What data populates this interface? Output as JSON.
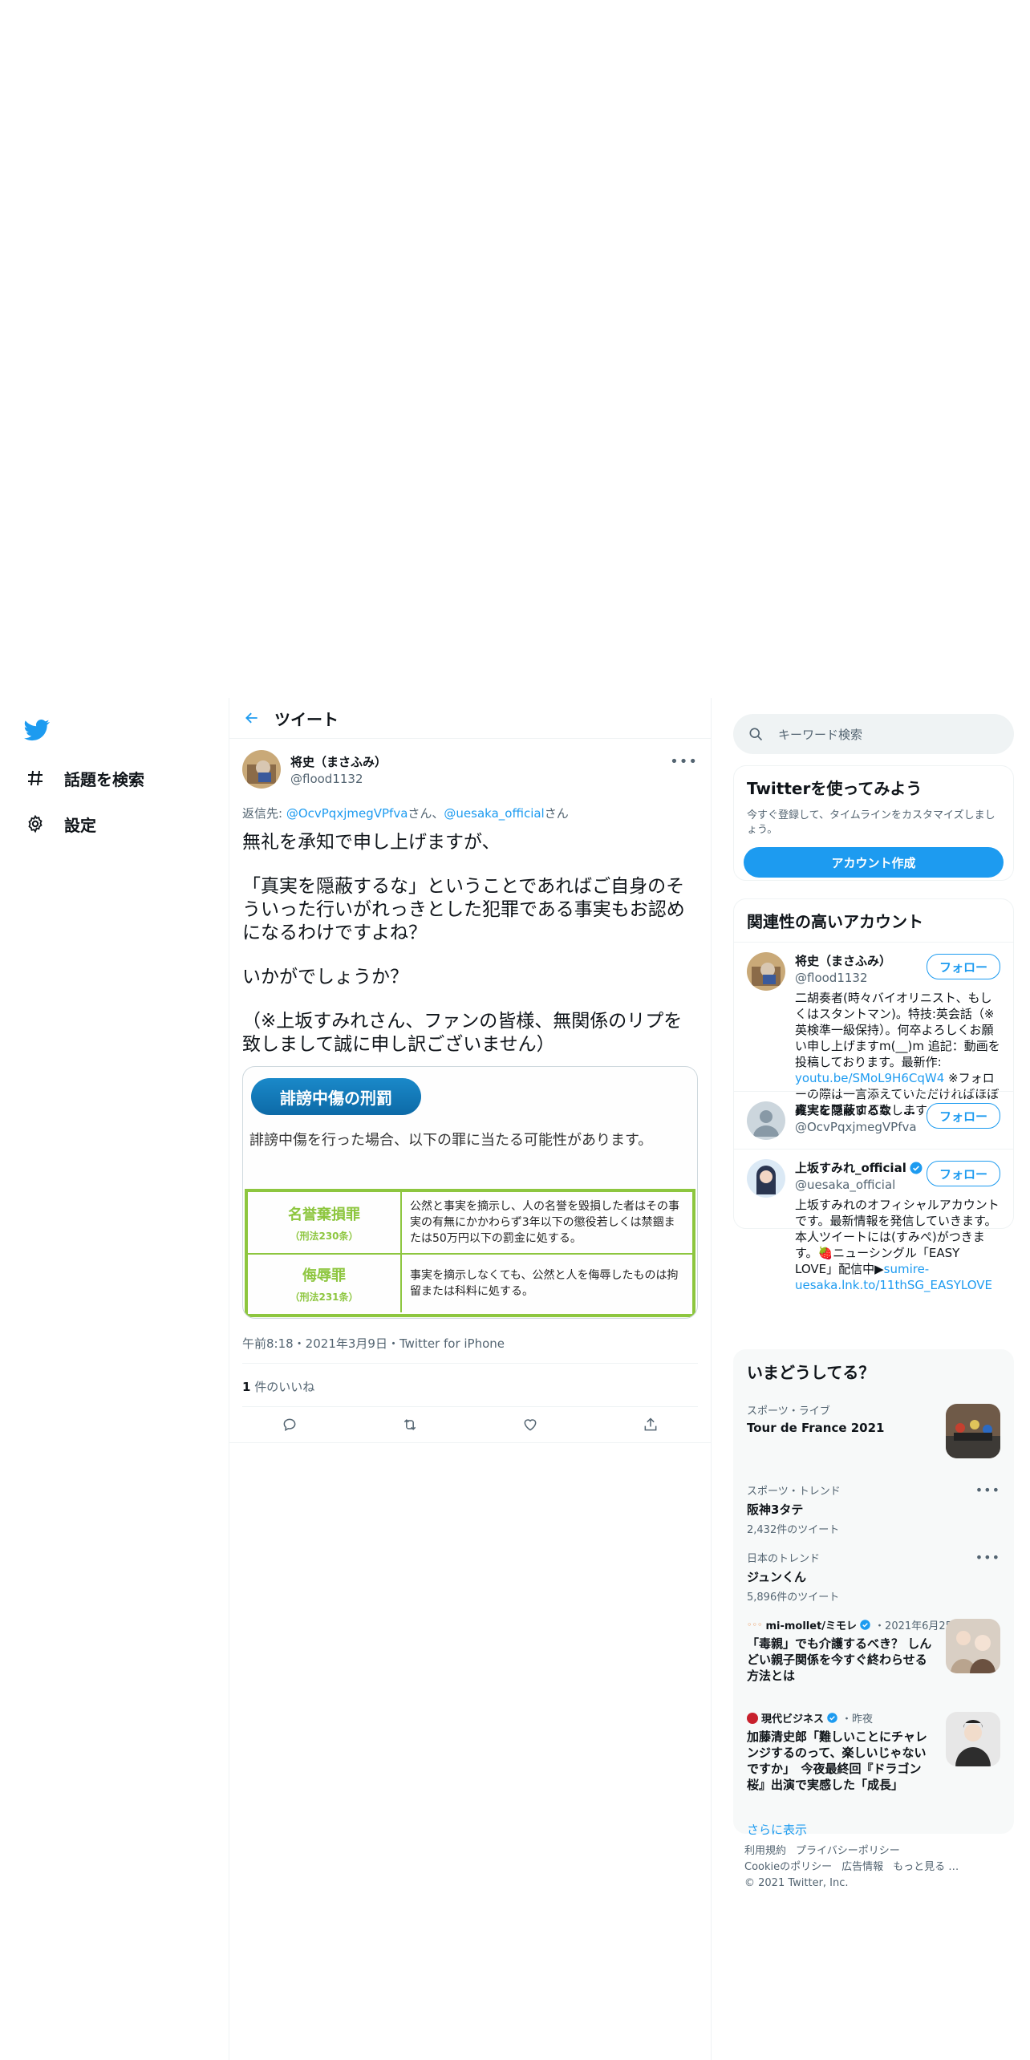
{
  "nav": {
    "explore_label": "話題を検索",
    "settings_label": "設定"
  },
  "header": {
    "title": "ツイート"
  },
  "tweet": {
    "display_name": "将史（まさふみ）",
    "handle": "@flood1132",
    "reply_prefix": "返信先: ",
    "reply_user1": "@OcvPqxjmegVPfva",
    "reply_san1": "さん、",
    "reply_user2": "@uesaka_official",
    "reply_san2": "さん",
    "line1": "無礼を承知で申し上げますが、",
    "line2": "「真実を隠蔽するな」ということであればご自身のそういった行いがれっきとした犯罪である事実もお認めになるわけですよね？",
    "line3": "いかがでしょうか？",
    "line4": "（※上坂すみれさん、ファンの皆様、無関係のリプを致しまして誠に申し訳ございません）",
    "image": {
      "title": "誹謗中傷の刑罰",
      "desc": "誹謗中傷を行った場合、以下の罪に当たる可能性があります。",
      "rows": [
        {
          "name": "名誉棄損罪",
          "law": "（刑法230条）",
          "text": "公然と事実を摘示し、人の名誉を毀損した者はその事実の有無にかかわらず3年以下の懲役若しくは禁錮または50万円以下の罰金に処する。"
        },
        {
          "name": "侮辱罪",
          "law": "（刑法231条）",
          "text": "事実を摘示しなくても、公然と人を侮辱したものは拘留または科料に処する。"
        }
      ]
    },
    "meta": "午前8:18・2021年3月9日・Twitter for iPhone",
    "like_count": "1",
    "like_label": " 件のいいね"
  },
  "search": {
    "placeholder": "キーワード検索"
  },
  "signup": {
    "title": "Twitterを使ってみよう",
    "subtitle": "今すぐ登録して、タイムラインをカスタマイズしましょう。",
    "button": "アカウント作成"
  },
  "related": {
    "title": "関連性の高いアカウント",
    "follow_label": "フォロー",
    "accounts": [
      {
        "name": "将史（まさふみ）",
        "handle": "@flood1132",
        "bio_pre": "二胡奏者(時々バイオリニスト、もしくはスタントマン)。特技:英会話（※英検準一級保持）。何卒よろしくお願い申し上げますm(__)m 追記：動画を投稿しております。最新作: ",
        "bio_link": "youtu.be/SMoL9H6CqW4",
        "bio_post": " ※フォローの際は一言添えていただければほぼ確実にフォロバ致します。"
      },
      {
        "name": "真実を隠蔽するな　…",
        "handle": "@OcvPqxjmegVPfva"
      },
      {
        "name": "上坂すみれ_official",
        "handle": "@uesaka_official",
        "bio_pre": "上坂すみれのオフィシャルアカウントです。最新情報を発信していきます。本人ツイートには(すみぺ)がつきます。🍓ニューシングル「EASY LOVE」配信中▶",
        "bio_link": "sumire-uesaka.lnk.to/11thSG_EASYLOVE",
        "bio_post": ""
      }
    ]
  },
  "trends": {
    "title": "いまどうしてる？",
    "items": [
      {
        "context": "スポーツ・ライブ",
        "name": "Tour de France 2021"
      },
      {
        "context": "スポーツ・トレンド",
        "name": "阪神3タテ",
        "count": "2,432件のツイート"
      },
      {
        "context": "日本のトレンド",
        "name": "ジュンくん",
        "count": "5,896件のツイート"
      }
    ],
    "news": [
      {
        "source": "mi-mollet/ミモレ",
        "time": "・2021年6月25日",
        "headline": "「毒親」でも介護するべき？ しんどい親子関係を今すぐ終わらせる方法とは"
      },
      {
        "source": "現代ビジネス",
        "time": "・昨夜",
        "headline": "加藤清史郎「難しいことにチャレンジするのって、楽しいじゃないですか」　今夜最終回『ドラゴン桜』出演で実感した「成長」"
      }
    ],
    "show_more": "さらに表示"
  },
  "footer": {
    "terms": "利用規約",
    "privacy": "プライバシーポリシー",
    "cookie": "Cookieのポリシー",
    "ads": "広告情報",
    "more": "もっと見る …",
    "copyright": "© 2021 Twitter, Inc."
  },
  "colors": {
    "accent": "#1d9bf0",
    "image_green": "#8dc63f",
    "image_blue": "#0d6aa7"
  }
}
